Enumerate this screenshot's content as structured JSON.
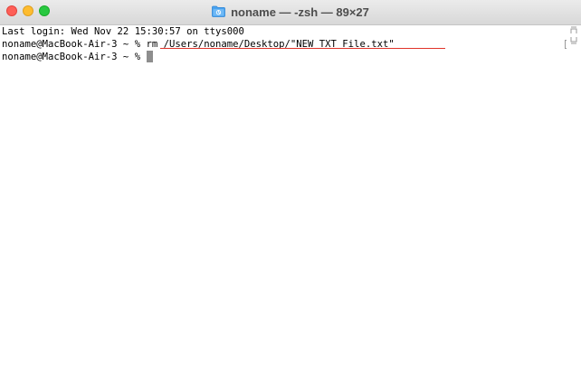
{
  "window": {
    "title": "noname — -zsh — 89×27"
  },
  "terminal": {
    "lines": [
      {
        "prompt": "",
        "text": "Last login: Wed Nov 22 15:30:57 on ttys000"
      },
      {
        "prompt": "noname@MacBook-Air-3 ~ % ",
        "command": "rm /Users/noname/Desktop/\"NEW TXT File.txt\""
      },
      {
        "prompt": "noname@MacBook-Air-3 ~ % ",
        "command": ""
      }
    ]
  },
  "icons": {
    "folder": "folder-icon",
    "scroll_up": "scroll-up-marker",
    "scroll_down": "scroll-down-marker"
  },
  "colors": {
    "close": "#fe5f57",
    "minimize": "#febc2e",
    "maximize": "#28c840",
    "underline": "#e0332a",
    "folder": "#4aa3f0"
  }
}
